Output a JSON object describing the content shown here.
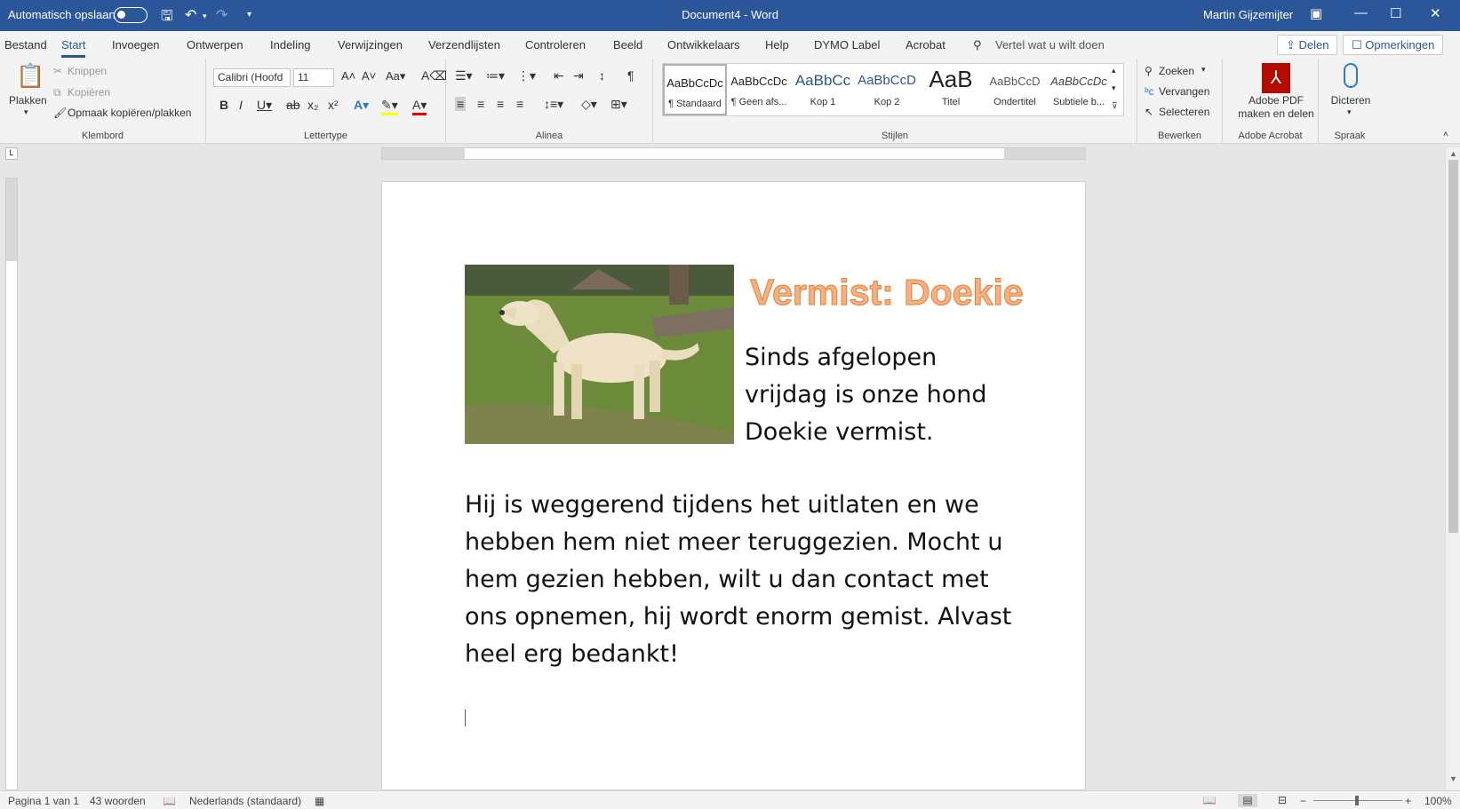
{
  "titlebar": {
    "autosave_label": "Automatisch opslaan",
    "doc_title": "Document4  -  Word",
    "user": "Martin Gijzemijter"
  },
  "menu": {
    "tabs": [
      "Bestand",
      "Start",
      "Invoegen",
      "Ontwerpen",
      "Indeling",
      "Verwijzingen",
      "Verzendlijsten",
      "Controleren",
      "Beeld",
      "Ontwikkelaars",
      "Help",
      "DYMO Label",
      "Acrobat"
    ],
    "active": "Start",
    "search_placeholder": "Vertel wat u wilt doen",
    "share": "Delen",
    "comments": "Opmerkingen"
  },
  "ribbon": {
    "clipboard": {
      "label": "Klembord",
      "paste": "Plakken",
      "cut": "Knippen",
      "copy": "Kopiëren",
      "format_painter": "Opmaak kopiëren/plakken"
    },
    "font": {
      "label": "Lettertype",
      "font_name": "Calibri (Hoofd",
      "font_size": "11"
    },
    "paragraph": {
      "label": "Alinea"
    },
    "styles": {
      "label": "Stijlen",
      "items": [
        {
          "preview": "AaBbCcDc",
          "name": "¶ Standaard"
        },
        {
          "preview": "AaBbCcDc",
          "name": "¶ Geen afs..."
        },
        {
          "preview": "AaBbCc",
          "name": "Kop 1"
        },
        {
          "preview": "AaBbCcD",
          "name": "Kop 2"
        },
        {
          "preview": "AaB",
          "name": "Titel"
        },
        {
          "preview": "AaBbCcD",
          "name": "Ondertitel"
        },
        {
          "preview": "AaBbCcDc",
          "name": "Subtiele b..."
        }
      ]
    },
    "editing": {
      "label": "Bewerken",
      "find": "Zoeken",
      "replace": "Vervangen",
      "select": "Selecteren"
    },
    "acrobat": {
      "label": "Adobe Acrobat",
      "button_line1": "Adobe PDF",
      "button_line2": "maken en delen"
    },
    "voice": {
      "label": "Spraak",
      "dictate": "Dicteren"
    }
  },
  "document": {
    "heading": "Vermist: Doekie",
    "side_text": "Sinds afgelopen vrijdag is onze hond Doekie vermist.",
    "body_text": "Hij is weggerend tijdens het uitlaten en we hebben hem niet meer teruggezien. Mocht u hem gezien hebben, wilt u dan contact met ons opnemen, hij wordt enorm gemist. Alvast heel erg bedankt!",
    "heading_color": "#f4b183"
  },
  "statusbar": {
    "page": "Pagina 1 van 1",
    "words": "43 woorden",
    "language": "Nederlands (standaard)",
    "zoom": "100%"
  },
  "colors": {
    "accent": "#2b579a"
  }
}
